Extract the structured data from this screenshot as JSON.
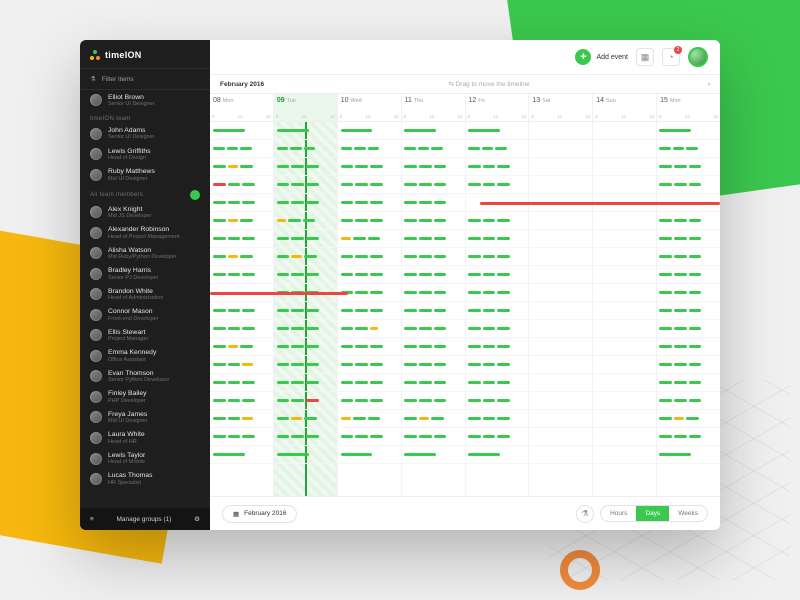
{
  "brand": "timeION",
  "sidebar": {
    "filter_label": "Filter items",
    "current_user": {
      "name": "Elliot Brown",
      "role": "Senior UI Designer"
    },
    "group1_label": "timeION team",
    "group1": [
      {
        "name": "John Adams",
        "role": "Senior UI Designer"
      },
      {
        "name": "Lewis Griffiths",
        "role": "Head of Design"
      },
      {
        "name": "Ruby Matthews",
        "role": "Mid UI Designer"
      }
    ],
    "group2_label": "All team members",
    "group2": [
      {
        "name": "Alex Knight",
        "role": "Mid JS Developer"
      },
      {
        "name": "Alexander Robinson",
        "role": "Head of Project Management"
      },
      {
        "name": "Alisha Watson",
        "role": "Mid Ruby/Python Developer"
      },
      {
        "name": "Bradley Harris",
        "role": "Senior PJ Developer"
      },
      {
        "name": "Brandon White",
        "role": "Head of Administration"
      },
      {
        "name": "Connor Mason",
        "role": "Front-end Developer"
      },
      {
        "name": "Ellis Stewart",
        "role": "Project Manager"
      },
      {
        "name": "Emma Kennedy",
        "role": "Office Assistant"
      },
      {
        "name": "Evan Thomson",
        "role": "Senior Python Developer"
      },
      {
        "name": "Finley Bailey",
        "role": "PHP Developer"
      },
      {
        "name": "Freya James",
        "role": "Mid UI Designer"
      },
      {
        "name": "Laura White",
        "role": "Head of HR"
      },
      {
        "name": "Lewis Taylor",
        "role": "Head of Mobile"
      },
      {
        "name": "Lucas Thomas",
        "role": "HR Specialist"
      }
    ],
    "footer": "Manage groups (1)"
  },
  "topbar": {
    "add_event": "Add event",
    "notif_count": "2"
  },
  "header": {
    "month": "February 2016",
    "drag_hint": "⇆  Drag to move the timeline",
    "nav_right": "›"
  },
  "days": [
    {
      "num": "08",
      "dow": "Mon"
    },
    {
      "num": "09",
      "dow": "Tue",
      "today": true
    },
    {
      "num": "10",
      "dow": "Wed"
    },
    {
      "num": "11",
      "dow": "Thu"
    },
    {
      "num": "12",
      "dow": "Fri"
    },
    {
      "num": "13",
      "dow": "Sat"
    },
    {
      "num": "14",
      "dow": "Sun"
    },
    {
      "num": "15",
      "dow": "Mon"
    }
  ],
  "day_hours": [
    "8",
    "12",
    "16"
  ],
  "timeline_rows": [
    [
      [
        "g",
        55
      ],
      [
        "g",
        55
      ],
      [
        "g",
        55
      ],
      [
        "g",
        55
      ],
      [
        "g",
        55
      ],
      [],
      [],
      [
        "g",
        55
      ]
    ],
    [
      [
        "g",
        20,
        "g",
        20,
        "g",
        20
      ],
      [
        "g",
        20,
        "g",
        20,
        "g",
        20
      ],
      [
        "g",
        20,
        "g",
        20,
        "g",
        20
      ],
      [
        "g",
        20,
        "g",
        20,
        "g",
        20
      ],
      [
        "g",
        20,
        "g",
        20,
        "g",
        20
      ],
      [],
      [],
      [
        "g",
        20,
        "g",
        20,
        "g",
        20
      ]
    ],
    [
      [
        "g",
        22,
        "y",
        18,
        "g",
        22
      ],
      [
        "g",
        22,
        "g",
        22,
        "g",
        22
      ],
      [
        "g",
        22,
        "g",
        22,
        "g",
        22
      ],
      [
        "g",
        22,
        "g",
        22,
        "g",
        22
      ],
      [
        "g",
        22,
        "g",
        22,
        "g",
        22
      ],
      [],
      [],
      [
        "g",
        22,
        "g",
        22,
        "g",
        22
      ]
    ],
    [
      [
        "r",
        22,
        "g",
        22,
        "g",
        22
      ],
      [
        "g",
        22,
        "g",
        22,
        "g",
        22
      ],
      [
        "g",
        22,
        "g",
        22,
        "g",
        22
      ],
      [
        "g",
        22,
        "g",
        22,
        "g",
        22
      ],
      [
        "g",
        22,
        "g",
        22,
        "g",
        22
      ],
      [],
      [],
      [
        "g",
        22,
        "g",
        22,
        "g",
        22
      ]
    ],
    [
      [
        "g",
        22,
        "g",
        22,
        "g",
        22
      ],
      [
        "g",
        22,
        "g",
        22,
        "g",
        22
      ],
      [
        "g",
        22,
        "g",
        22,
        "g",
        22
      ],
      [
        "g",
        22,
        "g",
        22,
        "g",
        22
      ],
      [],
      [],
      [],
      []
    ],
    [
      [
        "g",
        22,
        "y",
        18,
        "g",
        22
      ],
      [
        "y",
        16,
        "g",
        22,
        "g",
        22
      ],
      [
        "g",
        22,
        "g",
        22,
        "g",
        22
      ],
      [
        "g",
        22,
        "g",
        22,
        "g",
        22
      ],
      [
        "g",
        22,
        "g",
        22,
        "g",
        22
      ],
      [],
      [],
      [
        "g",
        22,
        "g",
        22,
        "g",
        22
      ]
    ],
    [
      [
        "g",
        22,
        "g",
        22,
        "g",
        22
      ],
      [
        "g",
        22,
        "g",
        22,
        "g",
        22
      ],
      [
        "y",
        18,
        "g",
        22,
        "g",
        22
      ],
      [
        "g",
        22,
        "g",
        22,
        "g",
        22
      ],
      [
        "g",
        22,
        "g",
        22,
        "g",
        22
      ],
      [],
      [],
      [
        "g",
        22,
        "g",
        22,
        "g",
        22
      ]
    ],
    [
      [
        "g",
        22,
        "y",
        18,
        "g",
        22
      ],
      [
        "g",
        22,
        "y",
        18,
        "g",
        22
      ],
      [
        "g",
        22,
        "g",
        22,
        "g",
        22
      ],
      [
        "g",
        22,
        "g",
        22,
        "g",
        22
      ],
      [
        "g",
        22,
        "g",
        22,
        "g",
        22
      ],
      [],
      [],
      [
        "g",
        22,
        "g",
        22,
        "g",
        22
      ]
    ],
    [
      [
        "g",
        22,
        "g",
        22,
        "g",
        22
      ],
      [
        "g",
        22,
        "g",
        22,
        "g",
        22
      ],
      [
        "g",
        22,
        "g",
        22,
        "g",
        22
      ],
      [
        "g",
        22,
        "g",
        22,
        "g",
        22
      ],
      [
        "g",
        22,
        "g",
        22,
        "g",
        22
      ],
      [],
      [],
      [
        "g",
        22,
        "g",
        22,
        "g",
        22
      ]
    ],
    [
      [],
      [
        "g",
        22,
        "g",
        22,
        "g",
        22
      ],
      [
        "g",
        22,
        "g",
        22,
        "g",
        22
      ],
      [
        "g",
        22,
        "g",
        22,
        "g",
        22
      ],
      [
        "g",
        22,
        "g",
        22,
        "g",
        22
      ],
      [],
      [],
      [
        "g",
        22,
        "g",
        22,
        "g",
        22
      ]
    ],
    [
      [
        "g",
        22,
        "g",
        22,
        "g",
        22
      ],
      [
        "g",
        22,
        "g",
        22,
        "g",
        22
      ],
      [
        "g",
        22,
        "g",
        22,
        "g",
        22
      ],
      [
        "g",
        22,
        "g",
        22,
        "g",
        22
      ],
      [
        "g",
        22,
        "g",
        22,
        "g",
        22
      ],
      [],
      [],
      [
        "g",
        22,
        "g",
        22,
        "g",
        22
      ]
    ],
    [
      [
        "g",
        22,
        "g",
        22,
        "g",
        22
      ],
      [
        "g",
        22,
        "g",
        22,
        "g",
        22
      ],
      [
        "g",
        22,
        "g",
        22,
        "y",
        14
      ],
      [
        "g",
        22,
        "g",
        22,
        "g",
        22
      ],
      [
        "g",
        22,
        "g",
        22,
        "g",
        22
      ],
      [],
      [],
      [
        "g",
        22,
        "g",
        22,
        "g",
        22
      ]
    ],
    [
      [
        "g",
        22,
        "y",
        18,
        "g",
        22
      ],
      [
        "g",
        22,
        "g",
        22,
        "g",
        22
      ],
      [
        "g",
        22,
        "g",
        22,
        "g",
        22
      ],
      [
        "g",
        22,
        "g",
        22,
        "g",
        22
      ],
      [
        "g",
        22,
        "g",
        22,
        "g",
        22
      ],
      [],
      [],
      [
        "g",
        22,
        "g",
        22,
        "g",
        22
      ]
    ],
    [
      [
        "g",
        22,
        "g",
        22,
        "y",
        18
      ],
      [
        "g",
        22,
        "g",
        22,
        "g",
        22
      ],
      [
        "g",
        22,
        "g",
        22,
        "g",
        22
      ],
      [
        "g",
        22,
        "g",
        22,
        "g",
        22
      ],
      [
        "g",
        22,
        "g",
        22,
        "g",
        22
      ],
      [],
      [],
      [
        "g",
        22,
        "g",
        22,
        "g",
        22
      ]
    ],
    [
      [
        "g",
        22,
        "g",
        22,
        "g",
        22
      ],
      [
        "g",
        22,
        "g",
        22,
        "g",
        22
      ],
      [
        "g",
        22,
        "g",
        22,
        "g",
        22
      ],
      [
        "g",
        22,
        "g",
        22,
        "g",
        22
      ],
      [
        "g",
        22,
        "g",
        22,
        "g",
        22
      ],
      [],
      [],
      [
        "g",
        22,
        "g",
        22,
        "g",
        22
      ]
    ],
    [
      [
        "g",
        22,
        "g",
        22,
        "g",
        22
      ],
      [
        "g",
        22,
        "g",
        22,
        "r",
        22
      ],
      [
        "g",
        22,
        "g",
        22,
        "g",
        22
      ],
      [
        "g",
        22,
        "g",
        22,
        "g",
        22
      ],
      [
        "g",
        22,
        "g",
        22,
        "g",
        22
      ],
      [],
      [],
      [
        "g",
        22,
        "g",
        22,
        "g",
        22
      ]
    ],
    [
      [
        "g",
        22,
        "g",
        22,
        "y",
        18
      ],
      [
        "g",
        22,
        "y",
        18,
        "g",
        22
      ],
      [
        "y",
        18,
        "g",
        22,
        "g",
        22
      ],
      [
        "g",
        22,
        "y",
        18,
        "g",
        22
      ],
      [
        "g",
        22,
        "g",
        22,
        "g",
        22
      ],
      [],
      [],
      [
        "g",
        22,
        "y",
        18,
        "g",
        22
      ]
    ],
    [
      [
        "g",
        22,
        "g",
        22,
        "g",
        22
      ],
      [
        "g",
        22,
        "g",
        22,
        "g",
        22
      ],
      [
        "g",
        22,
        "g",
        22,
        "g",
        22
      ],
      [
        "g",
        22,
        "g",
        22,
        "g",
        22
      ],
      [
        "g",
        22,
        "g",
        22,
        "g",
        22
      ],
      [],
      [],
      [
        "g",
        22,
        "g",
        22,
        "g",
        22
      ]
    ],
    [
      [
        "g",
        55
      ],
      [
        "g",
        55
      ],
      [
        "g",
        55
      ],
      [
        "g",
        55
      ],
      [
        "g",
        55
      ],
      [],
      [],
      [
        "g",
        55
      ]
    ]
  ],
  "long_bars": [
    {
      "row": 4,
      "left_pct": 53,
      "width_pct": 47
    },
    {
      "row": 9,
      "left_pct": 0,
      "width_pct": 27
    }
  ],
  "bottombar": {
    "date_label": "February 2016",
    "views": [
      "Hours",
      "Days",
      "Weeks"
    ],
    "active_view": "Days"
  },
  "colors": {
    "green": "#3bc84e",
    "yellow": "#f6b80e",
    "red": "#ef4444"
  }
}
